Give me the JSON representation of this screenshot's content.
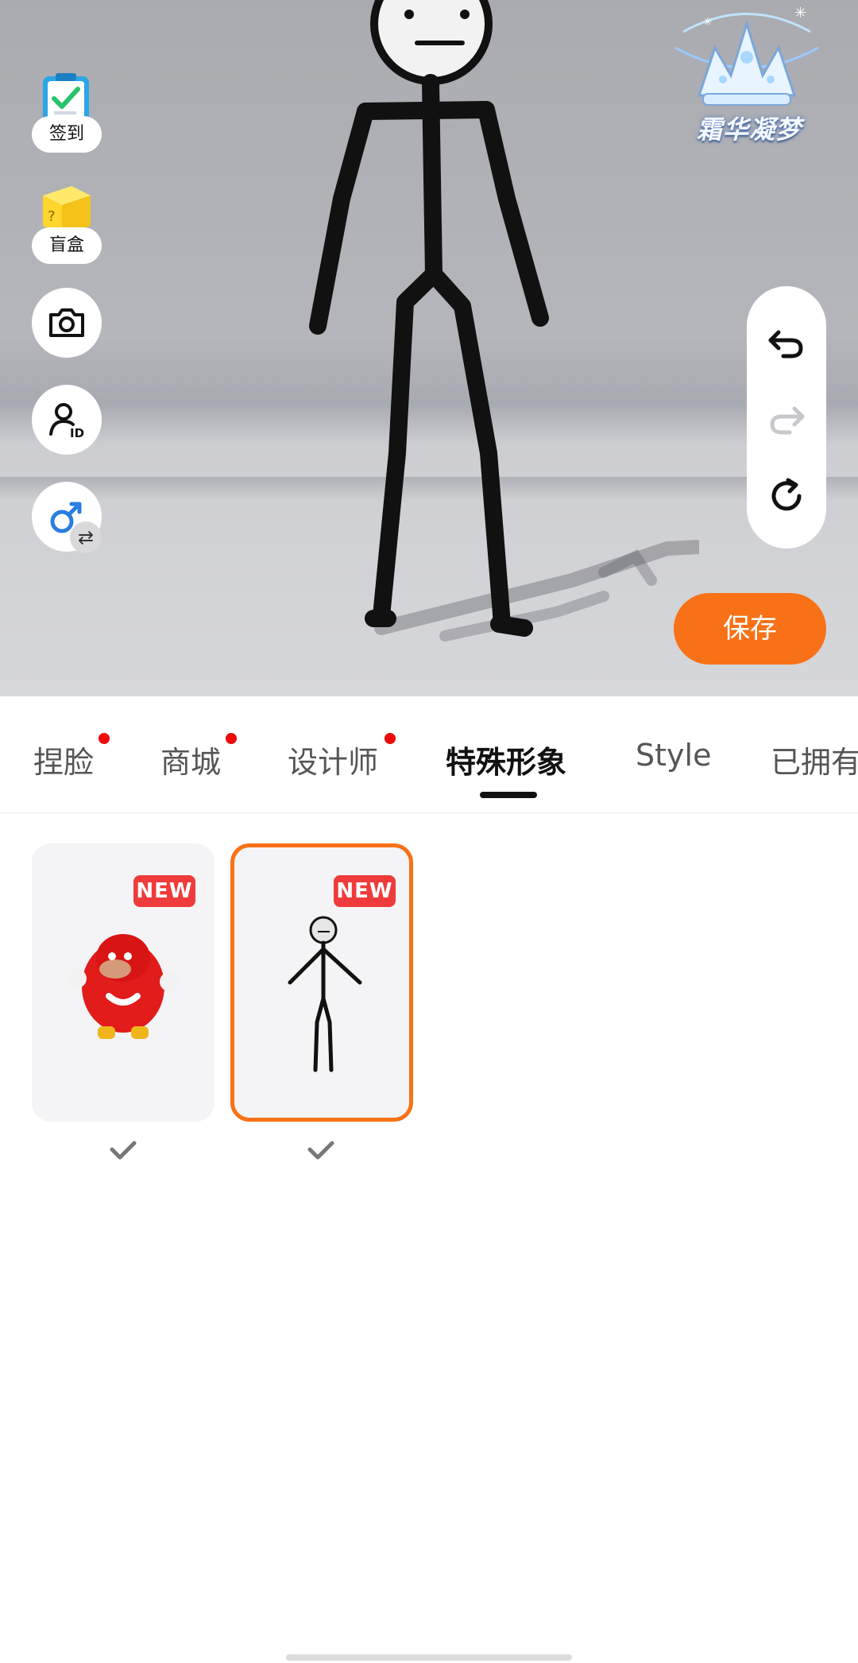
{
  "brand": {
    "logo_text": "霜华凝梦"
  },
  "left_tools": [
    {
      "label": "签到",
      "icon": "checkin-clipboard-icon"
    },
    {
      "label": "盲盒",
      "icon": "blind-box-icon"
    },
    {
      "label": "",
      "icon": "camera-icon"
    },
    {
      "label": "",
      "icon": "user-id-icon"
    },
    {
      "label": "",
      "icon": "gender-male-swap-icon"
    }
  ],
  "history_controls": {
    "undo_icon": "undo-icon",
    "redo_icon": "redo-icon",
    "reset_icon": "reset-icon"
  },
  "save_label": "保存",
  "tabs": [
    {
      "label": "捏脸",
      "has_dot": true
    },
    {
      "label": "商城",
      "has_dot": true
    },
    {
      "label": "设计师",
      "has_dot": true
    },
    {
      "label": "特殊形象",
      "active": true
    },
    {
      "label": "Style"
    },
    {
      "label": "已拥有"
    }
  ],
  "items": [
    {
      "badge": "NEW",
      "name": "red-knuckles-avatar",
      "selected": false
    },
    {
      "badge": "NEW",
      "name": "stick-figure-avatar",
      "selected": true
    }
  ],
  "colors": {
    "accent": "#f97116",
    "badge_red": "#ef3b3b",
    "dot_red": "#ee0a0a"
  }
}
